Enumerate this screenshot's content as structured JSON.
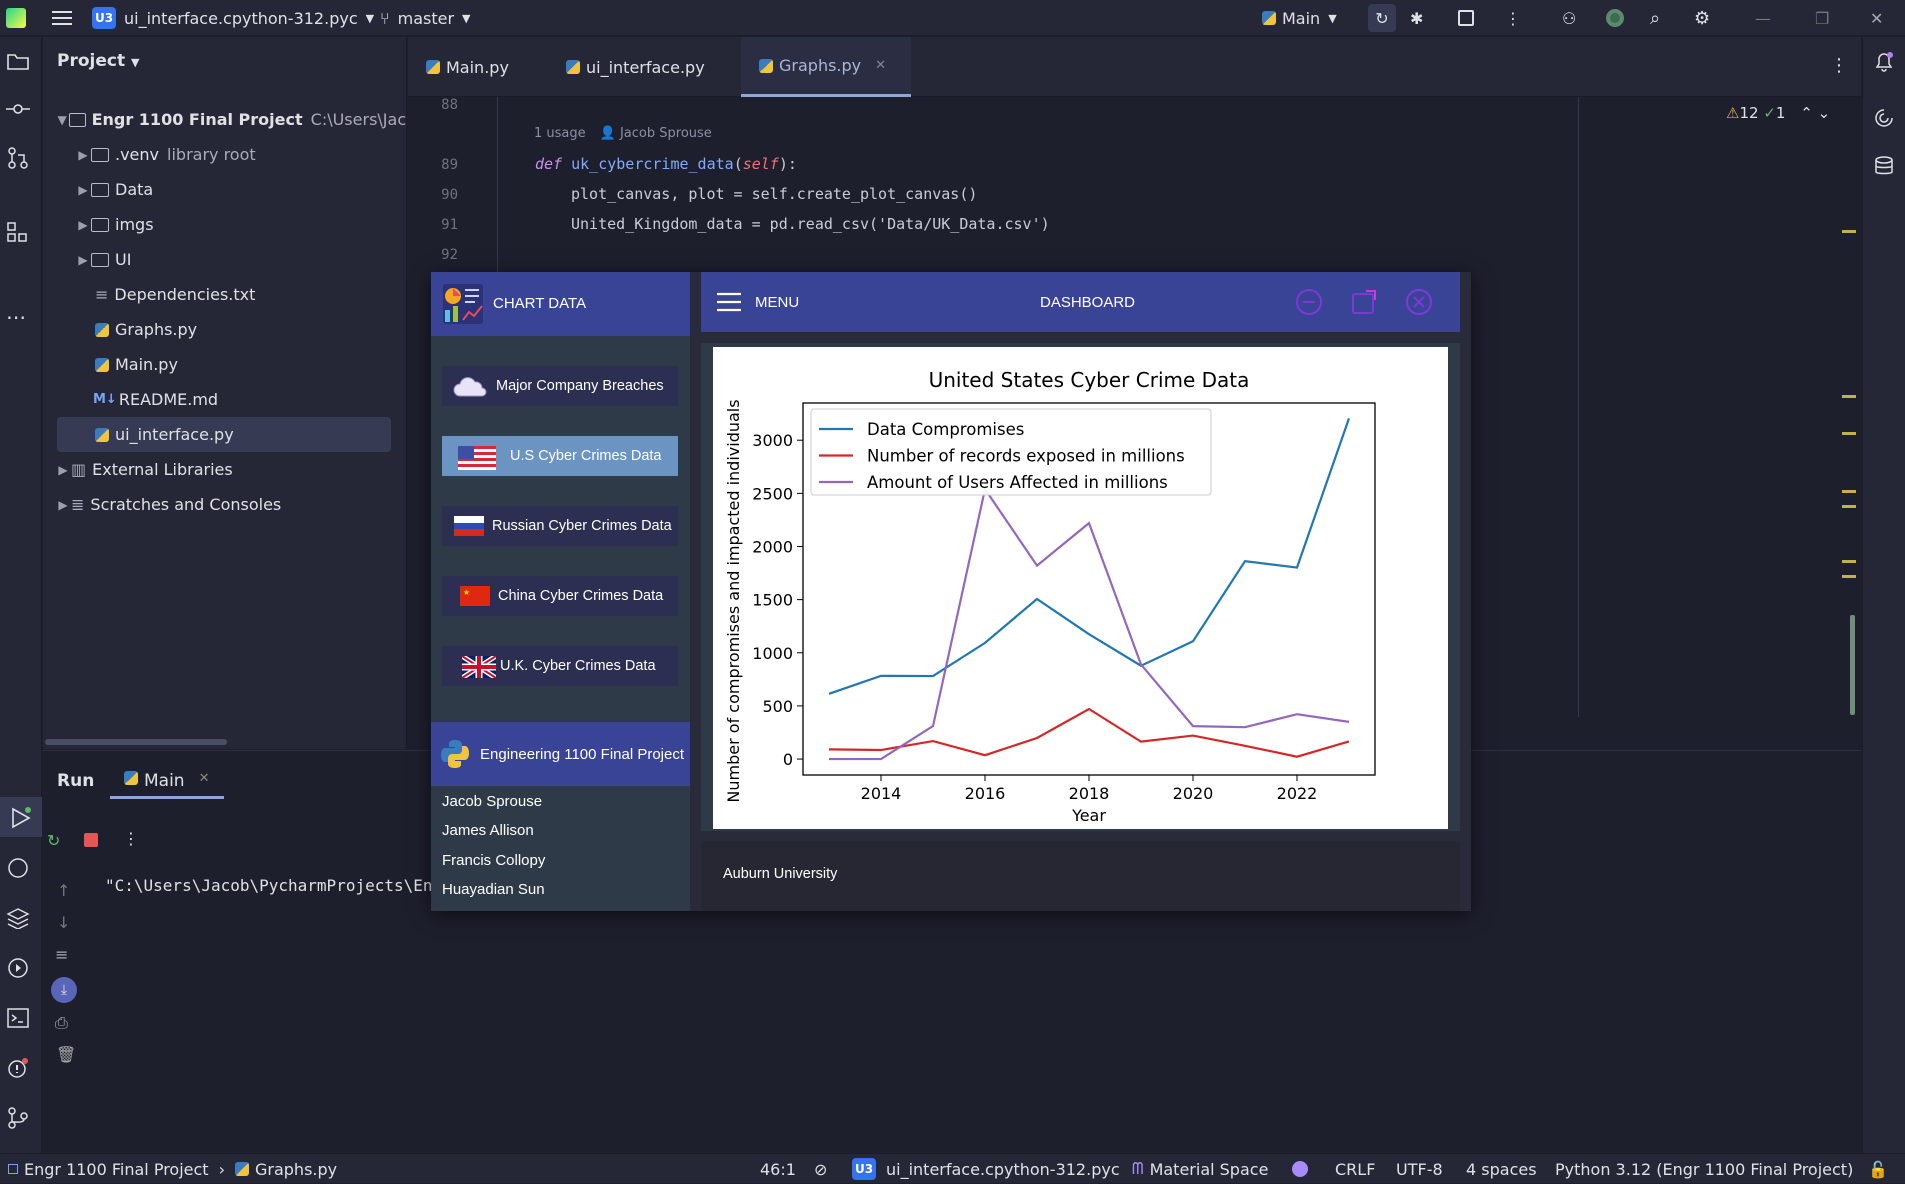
{
  "titlebar": {
    "project_badge": "U3",
    "file": "ui_interface.cpython-312.pyc",
    "branch": "master",
    "run_config": "Main"
  },
  "project": {
    "title": "Project",
    "items": [
      {
        "label": "Engr 1100 Final Project",
        "extra": "C:\\Users\\Jac"
      },
      {
        "label": ".venv",
        "extra": "library root"
      },
      {
        "label": "Data"
      },
      {
        "label": "imgs"
      },
      {
        "label": "UI"
      },
      {
        "label": "Dependencies.txt"
      },
      {
        "label": "Graphs.py"
      },
      {
        "label": "Main.py"
      },
      {
        "label": "README.md",
        "prefix": "M↓"
      },
      {
        "label": "ui_interface.py"
      },
      {
        "label": "External Libraries"
      },
      {
        "label": "Scratches and Consoles"
      }
    ]
  },
  "tabs": [
    {
      "label": "Main.py"
    },
    {
      "label": "ui_interface.py"
    },
    {
      "label": "Graphs.py"
    }
  ],
  "editor": {
    "lines": [
      "88",
      "89",
      "90",
      "91",
      "92"
    ],
    "usage": "1 usage",
    "author": "Jacob Sprouse",
    "code1_kw": "def",
    "code1_fn": "uk_cybercrime_data",
    "code1_self": "self",
    "code2": "plot_canvas, plot = self.create_plot_canvas()",
    "code3": "United_Kingdom_data = pd.read_csv('Data/UK_Data.csv')",
    "warnings": "12",
    "ok": "1"
  },
  "run": {
    "tab_run": "Run",
    "tab_main": "Main",
    "console": "\"C:\\Users\\Jacob\\PycharmProjects\\Engr"
  },
  "status": {
    "crumb1": "Engr 1100 Final Project",
    "crumb2": "Graphs.py",
    "pos": "46:1",
    "badge": "U3",
    "file": "ui_interface.cpython-312.pyc",
    "theme": "Material Space",
    "eol": "CRLF",
    "enc": "UTF-8",
    "indent": "4 spaces",
    "interp": "Python 3.12 (Engr 1100 Final Project)"
  },
  "app": {
    "side_title": "CHART DATA",
    "buttons": [
      "Major Company Breaches",
      "U.S Cyber Crimes Data",
      "Russian Cyber Crimes Data",
      "China Cyber Crimes Data",
      "U.K. Cyber Crimes Data"
    ],
    "footer_title": "Engineering 1100 Final Project",
    "members": [
      "Jacob Sprouse",
      "James Allison",
      "Francis Collopy",
      "Huayadian Sun"
    ],
    "menu": "MENU",
    "dashboard": "DASHBOARD",
    "university": "Auburn University"
  },
  "chart_data": {
    "type": "line",
    "title": "United States Cyber Crime Data",
    "xlabel": "Year",
    "ylabel": "Number of compromises and impacted individuals",
    "x": [
      2013,
      2014,
      2015,
      2016,
      2017,
      2018,
      2019,
      2020,
      2021,
      2022,
      2023
    ],
    "xticks": [
      2014,
      2016,
      2018,
      2020,
      2022
    ],
    "yticks": [
      0,
      500,
      1000,
      1500,
      2000,
      2500,
      3000
    ],
    "xlim": [
      2012.5,
      2023.5
    ],
    "ylim": [
      -150,
      3350
    ],
    "legend": "top-left",
    "grid": false,
    "series": [
      {
        "name": "Data Compromises",
        "color": "#1f77b4",
        "values": [
          614,
          783,
          781,
          1093,
          1506,
          1175,
          878,
          1108,
          1862,
          1802,
          3205
        ]
      },
      {
        "name": "Number of records exposed in millions",
        "color": "#d62728",
        "values": [
          91,
          85,
          169,
          36,
          198,
          471,
          164,
          221,
          125,
          22,
          166
        ]
      },
      {
        "name": "Amount of Users Affected in millions",
        "color": "#9467bd",
        "values": [
          0,
          0,
          310,
          2540,
          1820,
          2220,
          890,
          310,
          300,
          422,
          350
        ]
      }
    ]
  }
}
